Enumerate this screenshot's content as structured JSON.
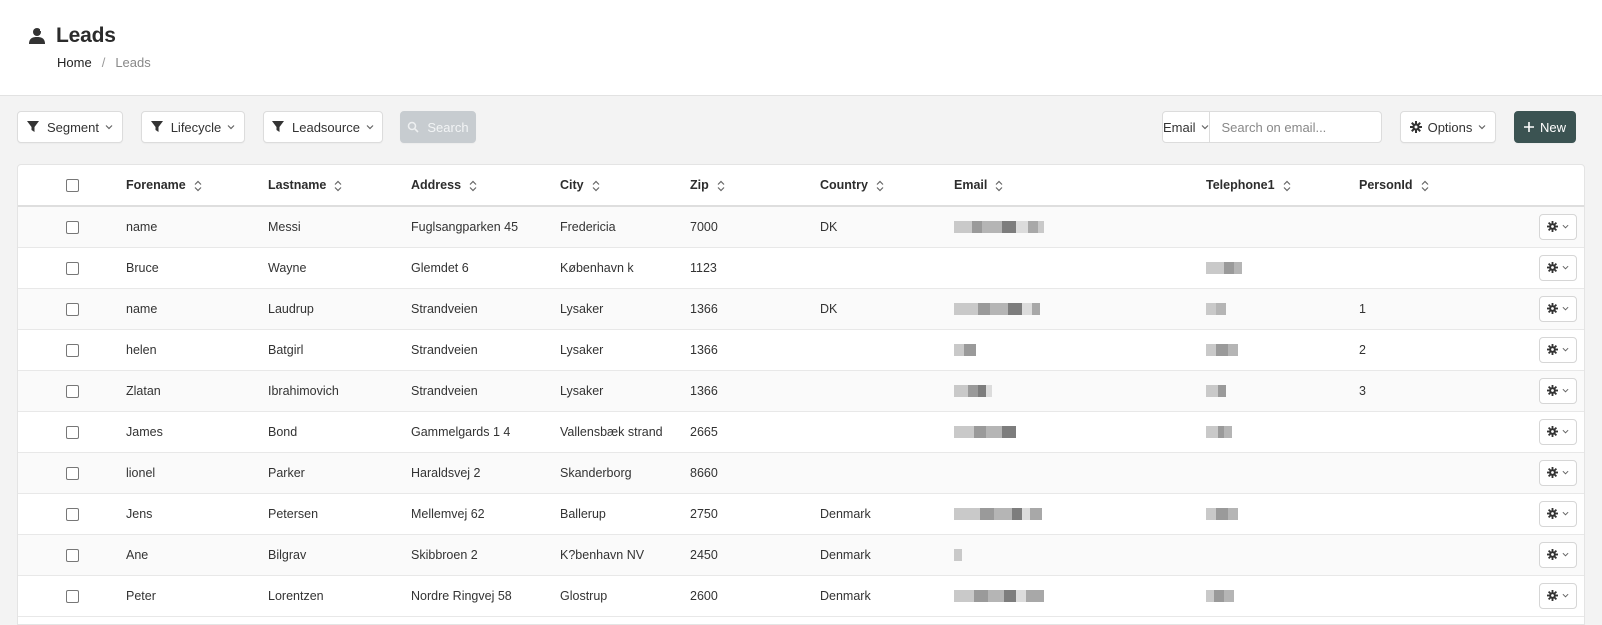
{
  "header": {
    "title": "Leads",
    "title_icon": "user-icon",
    "breadcrumb": {
      "home": "Home",
      "separator": "/",
      "current": "Leads"
    }
  },
  "filters": [
    {
      "label": "Segment",
      "icon": "filter-icon"
    },
    {
      "label": "Lifecycle",
      "icon": "filter-icon"
    },
    {
      "label": "Leadsource",
      "icon": "filter-icon"
    }
  ],
  "search_button": {
    "label": "Search",
    "icon": "search-icon"
  },
  "email_search": {
    "field": "Email",
    "placeholder": "Search on email..."
  },
  "options_button": {
    "label": "Options",
    "icon": "gear-icon"
  },
  "new_button": {
    "label": "New",
    "icon": "plus-icon"
  },
  "table": {
    "columns": [
      "Forename",
      "Lastname",
      "Address",
      "City",
      "Zip",
      "Country",
      "Email",
      "Telephone1",
      "PersonId"
    ],
    "rows": [
      [
        "name",
        "Messi",
        "Fuglsangparken 45",
        "Fredericia",
        "7000",
        "DK",
        "",
        "",
        ""
      ],
      [
        "Bruce",
        "Wayne",
        "Glemdet 6",
        "København k",
        "1123",
        "",
        "",
        "",
        ""
      ],
      [
        "name",
        "Laudrup",
        "Strandveien",
        "Lysaker",
        "1366",
        "DK",
        "",
        "",
        "1"
      ],
      [
        "helen",
        "Batgirl",
        "Strandveien",
        "Lysaker",
        "1366",
        "",
        "",
        "",
        "2"
      ],
      [
        "Zlatan",
        "Ibrahimovich",
        "Strandveien",
        "Lysaker",
        "1366",
        "",
        "",
        "",
        "3"
      ],
      [
        "James",
        "Bond",
        "Gammelgards 1 4",
        "Vallensbæk strand",
        "2665",
        "",
        "",
        "",
        ""
      ],
      [
        "lionel",
        "Parker",
        "Haraldsvej 2",
        "Skanderborg",
        "8660",
        "",
        "",
        "",
        ""
      ],
      [
        "Jens",
        "Petersen",
        "Mellemvej 62",
        "Ballerup",
        "2750",
        "Denmark",
        "",
        "",
        ""
      ],
      [
        "Ane",
        "Bilgrav",
        "Skibbroen 2",
        "K?benhavn NV",
        "2450",
        "Denmark",
        "",
        "",
        ""
      ],
      [
        "Peter",
        "Lorentzen",
        "Nordre Ringvej 58",
        "Glostrup",
        "2600",
        "Denmark",
        "",
        "",
        ""
      ]
    ]
  },
  "colors": {
    "accent": "#3b5352",
    "search_disabled": "#c7ccd0",
    "header_bg": "#ffffff",
    "page_bg": "#f3f3f3"
  }
}
